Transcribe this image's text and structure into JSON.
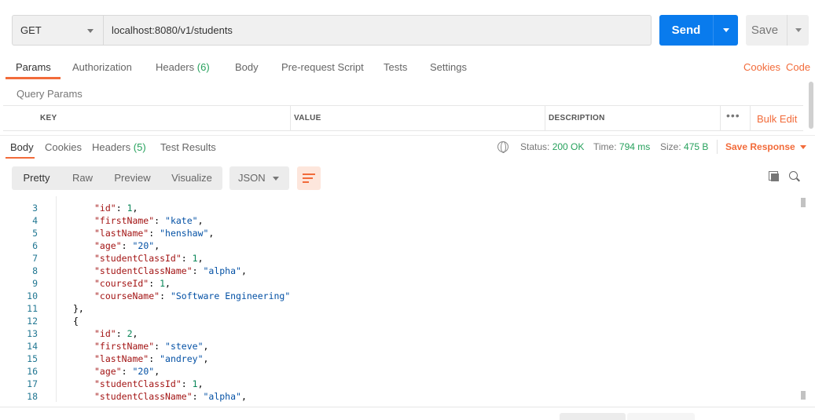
{
  "request": {
    "method": "GET",
    "url": "localhost:8080/v1/students",
    "send_label": "Send",
    "save_label": "Save"
  },
  "request_tabs": [
    {
      "label": "Params"
    },
    {
      "label": "Authorization"
    },
    {
      "label": "Headers",
      "count": "(6)"
    },
    {
      "label": "Body"
    },
    {
      "label": "Pre-request Script"
    },
    {
      "label": "Tests"
    },
    {
      "label": "Settings"
    }
  ],
  "request_links": {
    "cookies": "Cookies",
    "code": "Code"
  },
  "query_params": {
    "title": "Query Params",
    "columns": [
      "KEY",
      "VALUE",
      "DESCRIPTION"
    ],
    "more": "•••",
    "bulk_edit": "Bulk Edit"
  },
  "response_tabs": [
    {
      "label": "Body"
    },
    {
      "label": "Cookies"
    },
    {
      "label": "Headers",
      "count": "(5)"
    },
    {
      "label": "Test Results"
    }
  ],
  "response_meta": {
    "status_label": "Status:",
    "status_value": "200 OK",
    "time_label": "Time:",
    "time_value": "794 ms",
    "size_label": "Size:",
    "size_value": "475 B",
    "save_response": "Save Response"
  },
  "format_options": [
    "Pretty",
    "Raw",
    "Preview",
    "Visualize"
  ],
  "language": "JSON",
  "code_lines": [
    {
      "n": "3",
      "indent": 2,
      "key": "id",
      "value": "1",
      "vtype": "n",
      "comma": true
    },
    {
      "n": "4",
      "indent": 2,
      "key": "firstName",
      "value": "\"kate\"",
      "vtype": "s",
      "comma": true
    },
    {
      "n": "5",
      "indent": 2,
      "key": "lastName",
      "value": "\"henshaw\"",
      "vtype": "s",
      "comma": true
    },
    {
      "n": "6",
      "indent": 2,
      "key": "age",
      "value": "\"20\"",
      "vtype": "s",
      "comma": true
    },
    {
      "n": "7",
      "indent": 2,
      "key": "studentClassId",
      "value": "1",
      "vtype": "n",
      "comma": true
    },
    {
      "n": "8",
      "indent": 2,
      "key": "studentClassName",
      "value": "\"alpha\"",
      "vtype": "s",
      "comma": true
    },
    {
      "n": "9",
      "indent": 2,
      "key": "courseId",
      "value": "1",
      "vtype": "n",
      "comma": true
    },
    {
      "n": "10",
      "indent": 2,
      "key": "courseName",
      "value": "\"Software Engineering\"",
      "vtype": "s",
      "comma": false
    },
    {
      "n": "11",
      "indent": 1,
      "raw": "},"
    },
    {
      "n": "12",
      "indent": 1,
      "raw": "{"
    },
    {
      "n": "13",
      "indent": 2,
      "key": "id",
      "value": "2",
      "vtype": "n",
      "comma": true
    },
    {
      "n": "14",
      "indent": 2,
      "key": "firstName",
      "value": "\"steve\"",
      "vtype": "s",
      "comma": true
    },
    {
      "n": "15",
      "indent": 2,
      "key": "lastName",
      "value": "\"andrey\"",
      "vtype": "s",
      "comma": true
    },
    {
      "n": "16",
      "indent": 2,
      "key": "age",
      "value": "\"20\"",
      "vtype": "s",
      "comma": true
    },
    {
      "n": "17",
      "indent": 2,
      "key": "studentClassId",
      "value": "1",
      "vtype": "n",
      "comma": true
    },
    {
      "n": "18",
      "indent": 2,
      "key": "studentClassName",
      "value": "\"alpha\"",
      "vtype": "s",
      "comma": true
    }
  ],
  "colors": {
    "accent": "#f26b3a",
    "primary": "#097bed",
    "success": "#26a15c"
  }
}
